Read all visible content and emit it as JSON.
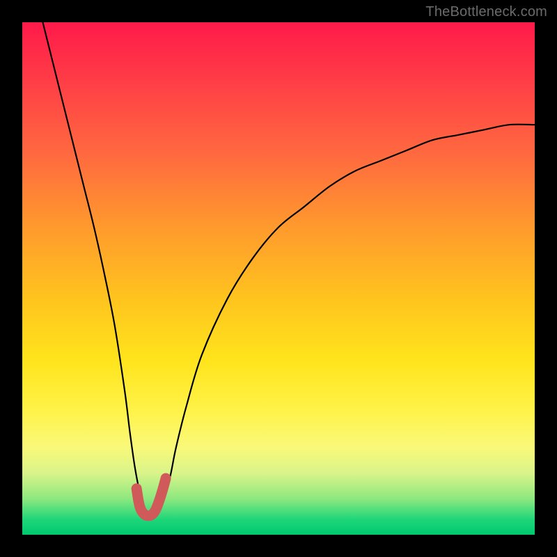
{
  "watermark": "TheBottleneck.com",
  "chart_data": {
    "type": "line",
    "title": "",
    "xlabel": "",
    "ylabel": "",
    "xlim": [
      0,
      100
    ],
    "ylim": [
      0,
      100
    ],
    "grid": false,
    "curve_black": {
      "name": "bottleneck-curve",
      "x": [
        4,
        6,
        8,
        10,
        12,
        14,
        16,
        18,
        20,
        21,
        22,
        23,
        24,
        25,
        26,
        27,
        28,
        29,
        30,
        32,
        35,
        40,
        45,
        50,
        55,
        60,
        65,
        70,
        75,
        80,
        85,
        90,
        95,
        100
      ],
      "y": [
        100,
        92,
        84,
        76,
        68,
        60,
        51,
        41,
        28,
        20,
        13,
        8,
        5,
        4,
        4,
        5,
        8,
        12,
        17,
        25,
        35,
        46,
        54,
        60,
        64,
        68,
        71,
        73,
        75,
        77,
        78,
        79,
        80,
        80
      ]
    },
    "highlight_red": {
      "name": "optimal-range",
      "x": [
        22.3,
        22.7,
        23.1,
        23.6,
        24.1,
        24.6,
        25.1,
        25.6,
        26.1,
        26.6,
        27.1,
        27.6,
        28.0
      ],
      "y": [
        9.0,
        6.5,
        5.0,
        4.2,
        3.8,
        3.7,
        3.8,
        4.2,
        5.0,
        6.3,
        7.8,
        9.5,
        11.0
      ]
    }
  }
}
